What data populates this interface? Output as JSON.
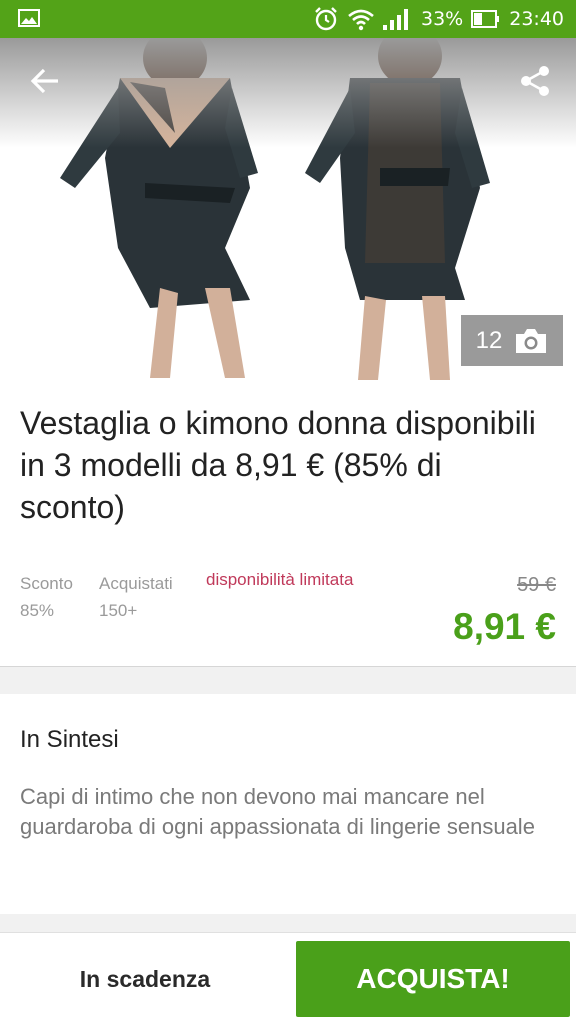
{
  "status_bar": {
    "battery": "33%",
    "time": "23:40"
  },
  "hero": {
    "photo_count": "12",
    "icons": [
      "back-arrow-icon",
      "share-icon",
      "camera-icon"
    ]
  },
  "product": {
    "title": "Vestaglia o kimono donna disponibili in 3 modelli da 8,91 € (85% di sconto)",
    "stats": [
      {
        "label": "Sconto",
        "value": "85%"
      },
      {
        "label": "Acquistati",
        "value": "150+"
      }
    ],
    "availability": "disponibilità limitata",
    "old_price": "59 €",
    "price": "8,91 €"
  },
  "summary": {
    "heading": "In Sintesi",
    "text": "Capi di intimo che non devono mai mancare nel guardaroba di ogni appassionata di lingerie sensuale"
  },
  "actions": {
    "expiring": "In scadenza",
    "buy": "ACQUISTA!"
  },
  "colors": {
    "brand": "#53a318",
    "price": "#4aa01a",
    "availability": "#c0395a"
  }
}
